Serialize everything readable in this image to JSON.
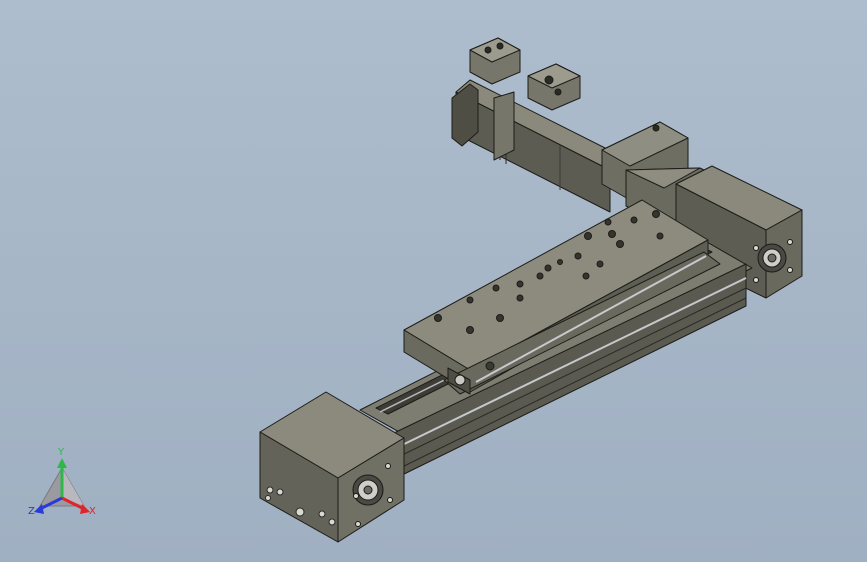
{
  "viewport": {
    "background_top": "#aebdcd",
    "background_bottom": "#9fb0c2"
  },
  "model": {
    "body_color": "#67665b",
    "body_light": "#8a897c",
    "body_dark": "#3f3e37",
    "edge_color": "#1c1c18",
    "rail_color": "#b4b8bb"
  },
  "triad": {
    "x_label": "X",
    "y_label": "Y",
    "z_label": "Z",
    "x_color": "#e0242c",
    "y_color": "#2fb84a",
    "z_color": "#2a3ad8"
  }
}
